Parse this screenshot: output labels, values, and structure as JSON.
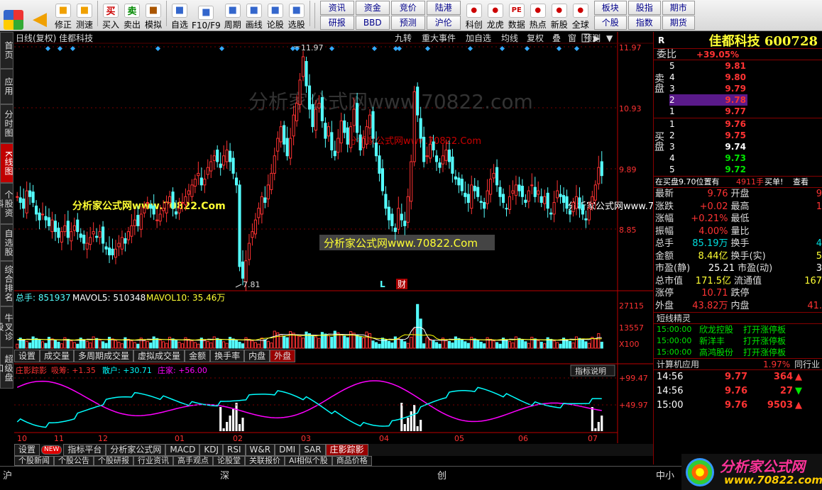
{
  "toolbar": {
    "buttons": [
      {
        "label": "修正",
        "icon": "up-arrow-icon"
      },
      {
        "label": "测速",
        "icon": "speed-icon"
      },
      {
        "label": "买入",
        "icon": "buy-icon",
        "glyph": "买"
      },
      {
        "label": "卖出",
        "icon": "sell-icon",
        "glyph": "卖"
      },
      {
        "label": "模拟",
        "icon": "hammer-icon"
      },
      {
        "label": "自选",
        "icon": "star-icon"
      },
      {
        "label": "F10/F9",
        "icon": "f10-icon"
      },
      {
        "label": "周期",
        "icon": "period-icon"
      },
      {
        "label": "画线",
        "icon": "pencil-icon"
      },
      {
        "label": "论股",
        "icon": "forum-icon"
      },
      {
        "label": "选股",
        "icon": "search-stock-icon"
      }
    ],
    "grid": [
      "资讯",
      "资金",
      "竞价",
      "陆港",
      "",
      "研报",
      "BBD",
      "预测",
      "沪伦",
      ""
    ],
    "buttons2": [
      {
        "label": "科创",
        "icon": "chart-icon"
      },
      {
        "label": "龙虎",
        "icon": "dragon-icon"
      },
      {
        "label": "数据",
        "icon": "pe-icon",
        "glyph": "PE"
      },
      {
        "label": "热点",
        "icon": "hot-icon"
      },
      {
        "label": "新股",
        "icon": "new-stock-icon"
      },
      {
        "label": "全球",
        "icon": "globe-icon"
      }
    ],
    "grid2": [
      "板块",
      "股指",
      "期市",
      "个股",
      "指数",
      "期货"
    ]
  },
  "left_tabs": [
    "首页",
    "应用",
    "分时图",
    "K线图",
    "个股资料",
    "自选股",
    "综合排名",
    "牛叉诊股",
    "超级盘口"
  ],
  "left_active": 3,
  "chart": {
    "header_left": "日线(复权)  佳都科技",
    "header_tabs": [
      "九转",
      "重大事件",
      "加自选",
      "均线",
      "复权",
      "叠",
      "窗",
      "预测"
    ],
    "price_axis": [
      "11.97",
      "10.93",
      "9.89",
      "8.85"
    ],
    "high_label": "11.97",
    "low_label": "7.81",
    "marker_L": "L",
    "marker_cai": "财",
    "watermark1": "分析家公式网www.70822.com",
    "watermark2": "分析家公式网www.70822.Com",
    "watermark3": "分析家公式网www.70822.Com",
    "watermark4": "分析家公式网www.70822.Com",
    "watermark5": "分析家公式网www.70822.Com",
    "vol_legend": {
      "total": "总手: 851937",
      "mavol5": "MAVOL5: 510348",
      "mavol10": "MAVOL10: 35.46万"
    },
    "vol_axis": [
      "27115",
      "13557",
      "X100"
    ],
    "vol_tabs": [
      "设置",
      "成交量",
      "多周期成交量",
      "虚拟成交量",
      "金额",
      "换手率",
      "内盘",
      "外盘"
    ],
    "ind_legend": {
      "name": "庄影踪影",
      "a": "吸筹: +1.35",
      "b": "散户: +30.71",
      "c": "庄家: +56.00"
    },
    "ind_button": "指标说明",
    "ind_axis": [
      "+99.47",
      "+49.97"
    ],
    "months": [
      "10",
      "11",
      "12",
      "01",
      "02",
      "03",
      "04",
      "05",
      "06",
      "07"
    ],
    "colors": {
      "up": "#ff3232",
      "down": "#54ffff",
      "ma5": "#ffffff",
      "ma10": "#ffff00",
      "zhuang": "#ff00ff",
      "sanhu": "#00ffff"
    }
  },
  "tabbar1": [
    "设置",
    "NEW",
    "指标平台",
    "分析家公式网",
    "MACD",
    "KDJ",
    "RSI",
    "W&R",
    "DMI",
    "SAR",
    "庄影踪影"
  ],
  "tabbar2": [
    "个股新闻",
    "个股公告",
    "个股研报",
    "行业资讯",
    "高手观点",
    "论股堂",
    "关联报价",
    "AI相似个股",
    "商品价格"
  ],
  "right": {
    "R": "R",
    "name": "佳都科技 600728",
    "weibi_label": "委比",
    "weibi": "+39.05%",
    "sell_label": "卖盘",
    "buy_label": "买盘",
    "sell": [
      {
        "n": "5",
        "p": "9.81"
      },
      {
        "n": "4",
        "p": "9.80"
      },
      {
        "n": "3",
        "p": "9.79"
      },
      {
        "n": "2",
        "p": "9.78"
      },
      {
        "n": "1",
        "p": "9.77"
      }
    ],
    "buy": [
      {
        "n": "1",
        "p": "9.76"
      },
      {
        "n": "2",
        "p": "9.75"
      },
      {
        "n": "3",
        "p": "9.74"
      },
      {
        "n": "4",
        "p": "9.73"
      },
      {
        "n": "5",
        "p": "9.72"
      }
    ],
    "ticker": "在买盘9.70位置有",
    "ticker2": "4911手",
    "ticker3": "买单!",
    "ticker4": "查看",
    "stats": [
      {
        "a": "最新",
        "av": "9.76",
        "b": "开盘",
        "bv": "9"
      },
      {
        "a": "涨跌",
        "av": "+0.02",
        "b": "最高",
        "bv": "1"
      },
      {
        "a": "涨幅",
        "av": "+0.21%",
        "b": "最低",
        "bv": ""
      },
      {
        "a": "振幅",
        "av": "4.00%",
        "b": "量比",
        "bv": ""
      },
      {
        "a": "总手",
        "av": "85.19万",
        "b": "换手",
        "bv": "4"
      },
      {
        "a": "金额",
        "av": "8.44亿",
        "b": "换手(实)",
        "bv": "5"
      },
      {
        "a": "市盈(静)",
        "av": "25.21",
        "b": "市盈(动)",
        "bv": "3"
      },
      {
        "a": "总市值",
        "av": "171.5亿",
        "b": "流通值",
        "bv": "167"
      },
      {
        "a": "涨停",
        "av": "10.71",
        "b": "跌停",
        "bv": ""
      },
      {
        "a": "外盘",
        "av": "43.82万",
        "b": "内盘",
        "bv": "41."
      }
    ],
    "short_title": "短线精灵",
    "short": [
      {
        "t": "15:00:00",
        "n": "欣龙控股",
        "e": "打开涨停板"
      },
      {
        "t": "15:00:00",
        "n": "新洋丰",
        "e": "打开涨停板"
      },
      {
        "t": "15:00:00",
        "n": "高鸿股份",
        "e": "打开涨停板"
      }
    ],
    "industry": "计算机应用",
    "industry_pct": "1.97%",
    "industry_btn": "同行业",
    "trades": [
      {
        "t": "14:56",
        "p": "9.77",
        "v": "364",
        "dir": "up"
      },
      {
        "t": "14:56",
        "p": "9.76",
        "v": "27",
        "dir": "down"
      },
      {
        "t": "15:00",
        "p": "9.76",
        "v": "9503",
        "dir": "up"
      }
    ]
  },
  "status": {
    "a": "沪",
    "b": "深",
    "c": "创",
    "d": "中小",
    "logo": "分析家公式网",
    "url": "www.70822.com"
  }
}
